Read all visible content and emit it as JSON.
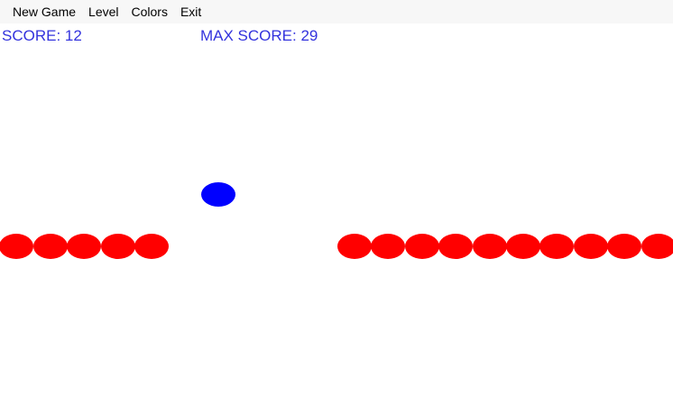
{
  "menu": {
    "items": [
      "New Game",
      "Level",
      "Colors",
      "Exit"
    ]
  },
  "hud": {
    "score_label": "SCORE: 12",
    "max_score_label": "MAX SCORE: 29",
    "score": 12,
    "max_score": 29,
    "text_color": "#3333dd"
  },
  "game": {
    "ball_color": "#0000ff",
    "segment_color": "#ff0000",
    "left_segment_count": 5,
    "right_segment_count": 10
  }
}
